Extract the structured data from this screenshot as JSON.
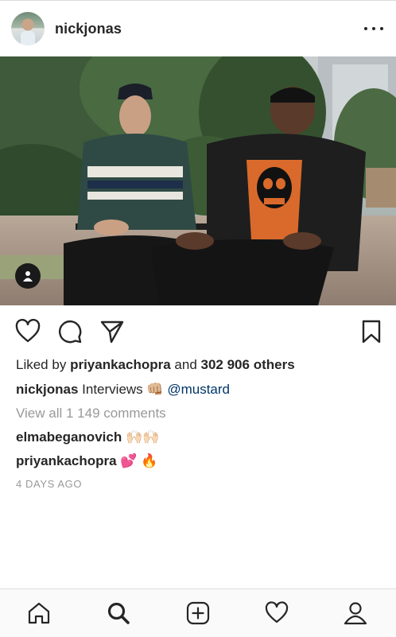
{
  "post": {
    "username": "nickjonas",
    "likes": {
      "prefix": "Liked by",
      "liker": "priyankachopra",
      "conjunction": "and",
      "others": "302 906 others"
    },
    "caption": {
      "author": "nickjonas",
      "text": "Interviews",
      "emoji": "👊🏼",
      "mention": "@mustard"
    },
    "view_comments": "View all 1 149 comments",
    "comments": [
      {
        "author": "elmabeganovich",
        "text": "🙌🏻🙌🏻"
      },
      {
        "author": "priyankachopra",
        "text": "💕 🔥"
      }
    ],
    "timestamp": "4 DAYS AGO"
  },
  "icons": {
    "header_more": "more-dots-icon",
    "image_tag": "user-tag-icon",
    "actions": [
      "heart-icon",
      "comment-icon",
      "share-icon",
      "bookmark-icon"
    ],
    "nav": [
      "home-icon",
      "search-icon",
      "add-post-icon",
      "activity-heart-icon",
      "profile-icon"
    ]
  },
  "colors": {
    "text": "#262626",
    "link": "#003569",
    "muted": "#999999",
    "border": "#dbdbdb",
    "nav_bg": "#fafafa"
  }
}
